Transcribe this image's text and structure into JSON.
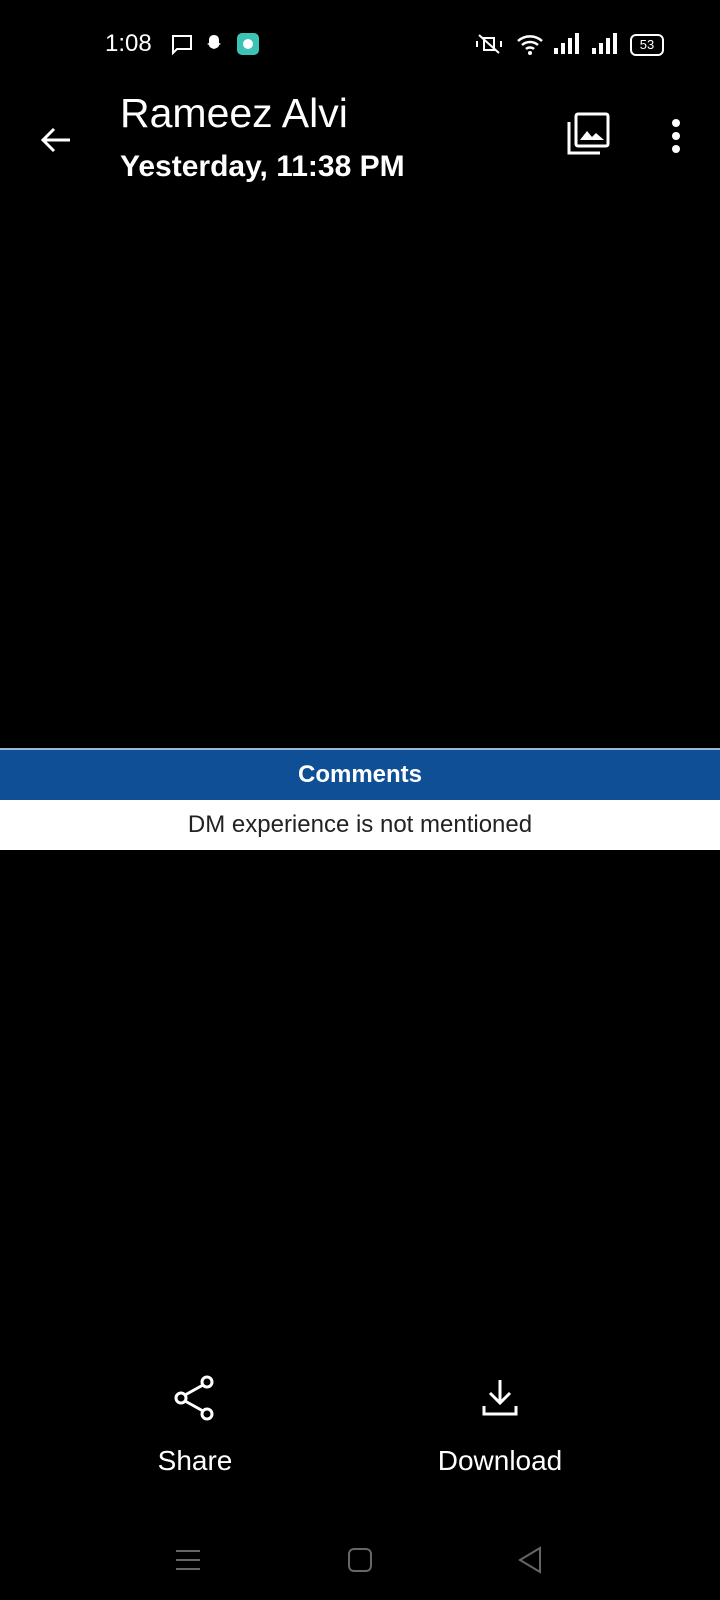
{
  "status_bar": {
    "time": "1:08",
    "battery": "53",
    "icons": [
      "message-icon",
      "snapchat-icon",
      "app-icon",
      "vibrate-off-icon",
      "wifi-icon",
      "signal-icon",
      "signal-icon",
      "battery-icon"
    ]
  },
  "header": {
    "title": "Rameez Alvi",
    "subtitle": "Yesterday, 11:38 PM"
  },
  "image_content": {
    "header": "Comments",
    "row": "DM experience is not mentioned"
  },
  "actions": {
    "share": "Share",
    "download": "Download"
  },
  "colors": {
    "background": "#000000",
    "table_header": "#0e4f95",
    "app_icon": "#3cc3b6"
  }
}
